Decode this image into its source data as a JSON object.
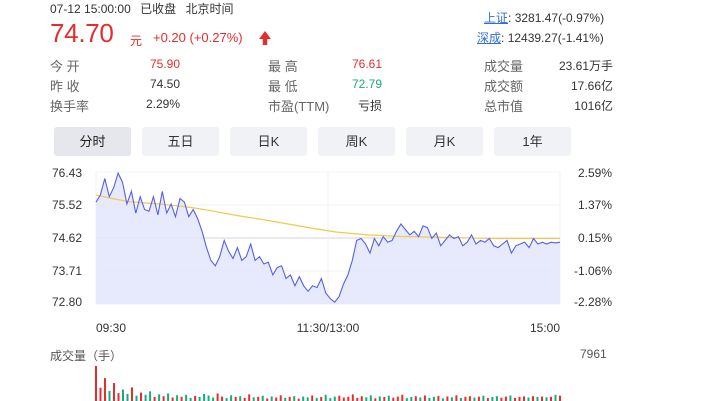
{
  "header": {
    "datetime": "07-12 15:00:00",
    "status": "已收盘",
    "timezone": "北京时间",
    "price": "74.70",
    "currency": "元",
    "change": "+0.20 (+0.27%)"
  },
  "indices": [
    {
      "name": "上证",
      "value": "3281.47(-0.97%)"
    },
    {
      "name": "深成",
      "value": "12439.27(-1.41%)"
    }
  ],
  "stats": {
    "col1": [
      {
        "label": "今  开",
        "value": "75.90",
        "color": "#e62d2d"
      },
      {
        "label": "昨  收",
        "value": "74.50",
        "color": "#333333"
      },
      {
        "label": "换手率",
        "value": "2.29%",
        "color": "#333333"
      }
    ],
    "col2": [
      {
        "label": "最  高",
        "value": "76.61",
        "color": "#e62d2d"
      },
      {
        "label": "最  低",
        "value": "72.79",
        "color": "#1aab7a"
      },
      {
        "label": "市盈(TTM)",
        "value": "亏损",
        "color": "#333333"
      }
    ],
    "col3": [
      {
        "label": "成交量",
        "value": "23.61万手"
      },
      {
        "label": "成交额",
        "value": "17.66亿"
      },
      {
        "label": "总市值",
        "value": "1016亿"
      }
    ]
  },
  "tabs": [
    "分时",
    "五日",
    "日K",
    "周K",
    "月K",
    "1年"
  ],
  "active_tab": "分时",
  "colors": {
    "up": "#e62d2d",
    "down": "#1aab7a",
    "price_line": "#5560e8",
    "avg_line": "#f2c94c",
    "fill": "#e3e5fb"
  },
  "chart_data": {
    "type": "line",
    "y_ticks_left": [
      "76.43",
      "75.52",
      "74.62",
      "73.71",
      "72.80"
    ],
    "y_ticks_right": [
      "2.59%",
      "1.37%",
      "0.15%",
      "-1.06%",
      "-2.28%"
    ],
    "x_ticks": [
      "09:30",
      "11:30/13:00",
      "15:00"
    ],
    "ylim": [
      72.8,
      76.43
    ],
    "prev_close": 74.5,
    "volume_label": "成交量（手）",
    "volume_max": "7961",
    "series": [
      {
        "name": "price",
        "values": [
          75.6,
          75.8,
          76.25,
          75.75,
          76.0,
          76.4,
          76.15,
          75.55,
          75.9,
          75.3,
          75.75,
          75.4,
          75.35,
          75.75,
          75.25,
          75.9,
          75.3,
          75.55,
          75.2,
          75.7,
          75.6,
          75.2,
          75.4,
          75.15,
          74.8,
          74.35,
          74.0,
          73.85,
          74.1,
          74.55,
          74.25,
          74.05,
          74.35,
          74.0,
          74.1,
          74.45,
          74.0,
          74.1,
          73.9,
          73.95,
          73.6,
          73.8,
          73.85,
          73.5,
          73.6,
          73.3,
          73.55,
          73.3,
          73.15,
          73.3,
          73.25,
          73.5,
          73.1,
          72.95,
          72.85,
          73.0,
          73.35,
          73.6,
          74.0,
          74.55,
          74.6,
          74.45,
          74.2,
          74.6,
          74.4,
          74.65,
          74.5,
          74.55,
          74.8,
          75.0,
          74.85,
          74.7,
          74.8,
          74.65,
          74.95,
          74.9,
          74.6,
          74.75,
          74.4,
          74.55,
          74.7,
          74.6,
          74.65,
          74.4,
          74.5,
          74.7,
          74.45,
          74.55,
          74.5,
          74.6,
          74.4,
          74.35,
          74.45,
          74.55,
          74.2,
          74.4,
          74.45,
          74.5,
          74.35,
          74.6,
          74.45,
          74.5,
          74.45,
          74.5,
          74.48,
          74.5
        ]
      },
      {
        "name": "average",
        "values": [
          75.8,
          75.7,
          75.62,
          75.58,
          75.55,
          75.5,
          75.45,
          75.38,
          75.3,
          75.22,
          75.15,
          75.08,
          75.0,
          74.92,
          74.85,
          74.78,
          74.74,
          74.7,
          74.68,
          74.66,
          74.65,
          74.64,
          74.63,
          74.62,
          74.61,
          74.6,
          74.6,
          74.6,
          74.6,
          74.6
        ]
      }
    ],
    "volume": [
      7961,
      3000,
      5200,
      2300,
      4100,
      1800,
      2600,
      1600,
      3100,
      1200,
      1900,
      1400,
      2200,
      900,
      1500,
      1100,
      1700,
      800,
      1300,
      950,
      1400,
      700,
      1150,
      900,
      1600,
      1250,
      800,
      1700,
      1000,
      650,
      1300,
      900,
      1100,
      700,
      1500,
      850,
      950,
      1200,
      600,
      1050,
      800,
      1300,
      700,
      950,
      1100,
      550,
      1000,
      850,
      1250,
      700,
      900,
      1400,
      650,
      1000,
      1200,
      800,
      950,
      1500,
      700,
      1100,
      850,
      1300,
      600,
      1050,
      900,
      1200,
      750,
      1000,
      1400,
      650,
      900,
      1100,
      800,
      1250,
      700,
      950,
      1150,
      600,
      1050,
      850,
      1300,
      700,
      950,
      1100,
      800,
      1000,
      1200,
      650,
      900,
      1100,
      750,
      1000,
      1250,
      700,
      950,
      1050,
      800,
      1100,
      900,
      1000,
      850,
      950,
      1400,
      1200
    ]
  }
}
